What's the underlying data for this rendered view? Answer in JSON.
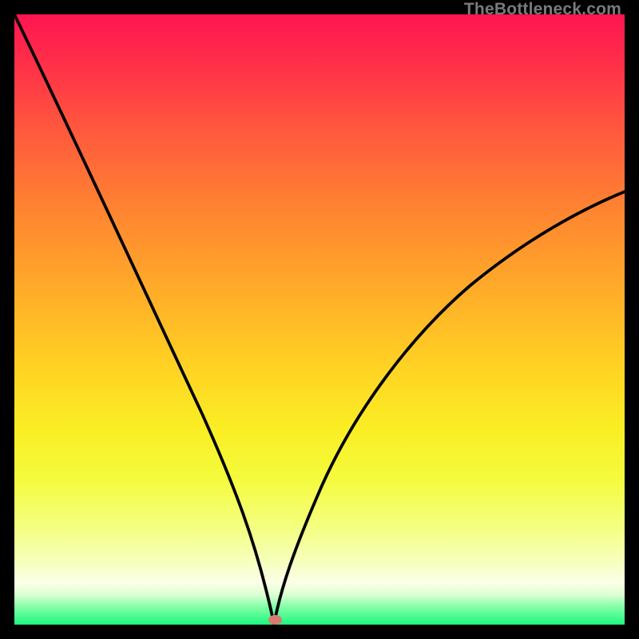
{
  "watermark": "TheBottleneck.com",
  "colors": {
    "frame": "#000000",
    "curve": "#000000",
    "marker": "#d87c6f",
    "gradient_top": "#ff1450",
    "gradient_bottom": "#1cf77f"
  },
  "chart_data": {
    "type": "line",
    "title": "",
    "xlabel": "",
    "ylabel": "",
    "xlim": [
      0,
      100
    ],
    "ylim": [
      0,
      100
    ],
    "grid": false,
    "series": [
      {
        "name": "left-curve",
        "x": [
          0,
          5,
          10,
          15,
          20,
          25,
          30,
          35,
          38,
          40,
          41,
          42
        ],
        "values": [
          100,
          86,
          73,
          60,
          48,
          37,
          26,
          15,
          8,
          3,
          1,
          0
        ]
      },
      {
        "name": "right-curve",
        "x": [
          42,
          44,
          47,
          50,
          55,
          60,
          65,
          70,
          75,
          80,
          85,
          90,
          95,
          100
        ],
        "values": [
          0,
          3,
          8,
          13,
          21,
          29,
          36,
          42,
          48,
          53,
          58,
          63,
          67,
          71
        ]
      }
    ],
    "marker": {
      "x": 42.5,
      "y": 0.5,
      "color": "#d87c6f"
    }
  }
}
